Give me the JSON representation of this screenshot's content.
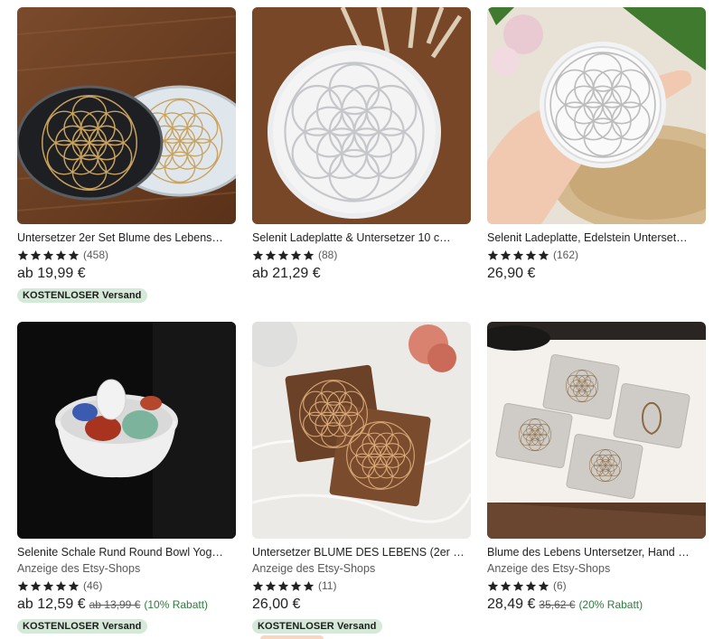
{
  "colors": {
    "badge_bg": "#d4e9d7",
    "discount_text": "#2f7a3e",
    "star": "#222222"
  },
  "products": [
    {
      "title": "Untersetzer 2er Set Blume des Lebens…",
      "shop_label": "",
      "rating_count": "(458)",
      "stars": 5,
      "price": "ab 19,99 €",
      "original_price": "",
      "discount": "",
      "badge": "KOSTENLOSER Versand"
    },
    {
      "title": "Selenit Ladeplatte & Untersetzer 10 c…",
      "shop_label": "",
      "rating_count": "(88)",
      "stars": 5,
      "price": "ab 21,29 €",
      "original_price": "",
      "discount": "",
      "badge": ""
    },
    {
      "title": "Selenit Ladeplatte, Edelstein Unterset…",
      "shop_label": "",
      "rating_count": "(162)",
      "stars": 5,
      "price": "26,90 €",
      "original_price": "",
      "discount": "",
      "badge": ""
    },
    {
      "title": "Selenite Schale Rund Round Bowl Yog…",
      "shop_label": "Anzeige des Etsy-Shops",
      "rating_count": "(46)",
      "stars": 5,
      "price": "ab 12,59 €",
      "original_price": "ab 13,99 €",
      "discount": "(10% Rabatt)",
      "badge": "KOSTENLOSER Versand"
    },
    {
      "title": "Untersetzer BLUME DES LEBENS (2er S…",
      "shop_label": "Anzeige des Etsy-Shops",
      "rating_count": "(11)",
      "stars": 5,
      "price": "26,00 €",
      "original_price": "",
      "discount": "",
      "badge": "KOSTENLOSER Versand"
    },
    {
      "title": "Blume des Lebens Untersetzer, Hand …",
      "shop_label": "Anzeige des Etsy-Shops",
      "rating_count": "(6)",
      "stars": 5,
      "price": "28,49 €",
      "original_price": "35,62 €",
      "discount": "(20% Rabatt)",
      "badge": ""
    }
  ]
}
